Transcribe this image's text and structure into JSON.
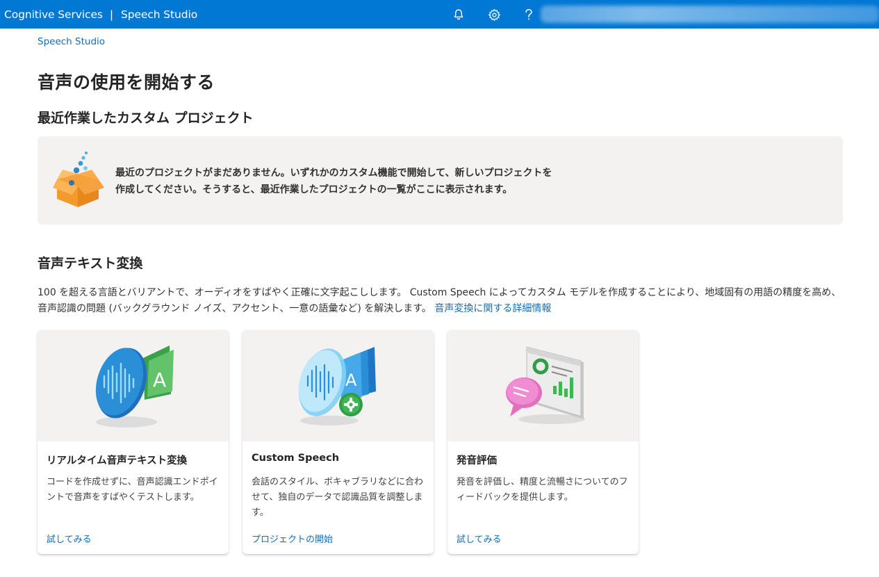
{
  "header": {
    "product": "Cognitive Services",
    "separator": "|",
    "app": "Speech Studio",
    "icons": [
      "bell-icon",
      "gear-icon",
      "help-icon"
    ],
    "accent_color": "#0078d4"
  },
  "breadcrumb": "Speech Studio",
  "page_title": "音声の使用を開始する",
  "recent": {
    "title": "最近作業したカスタム プロジェクト",
    "empty_line1": "最近のプロジェクトがまだありません。いずれかのカスタム機能で開始して、新しいプロジェクトを",
    "empty_line2": "作成してください。そうすると、最近作業したプロジェクトの一覧がここに表示されます。"
  },
  "stt": {
    "title": "音声テキスト変換",
    "description": "100 を超える言語とバリアントで、オーディオをすばやく正確に文字起こしします。 Custom Speech によってカスタム モデルを作成することにより、地域固有の用語の精度を高め、音声認識の問題 (バックグラウンド ノイズ、アクセント、一意の語彙など) を解決します。",
    "learn_more": "音声変換に関する詳細情報"
  },
  "cards": [
    {
      "title": "リアルタイム音声テキスト変換",
      "description": "コードを作成せずに、音声認識エンドポイントで音声をすばやくテストします。",
      "action": "試してみる"
    },
    {
      "title": "Custom Speech",
      "description": "会話のスタイル、ボキャブラリなどに合わせて、独自のデータで認識品質を調整します。",
      "action": "プロジェクトの開始"
    },
    {
      "title": "発音評価",
      "description": "発音を評価し、精度と流暢さについてのフィードバックを提供します。",
      "action": "試してみる"
    }
  ]
}
